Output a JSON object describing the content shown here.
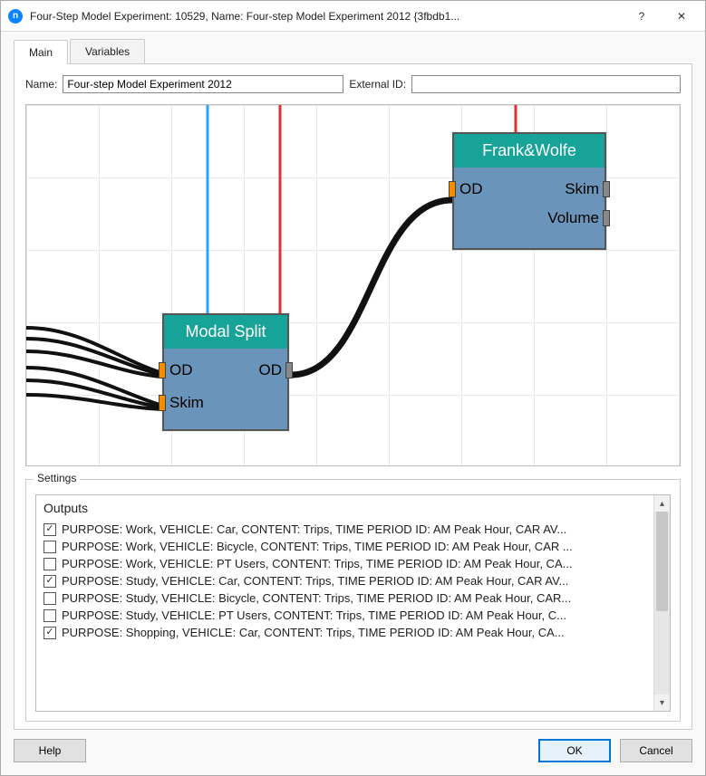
{
  "window": {
    "title": "Four-Step Model Experiment: 10529, Name: Four-step Model Experiment 2012  {3fbdb1...",
    "help_glyph": "?",
    "close_glyph": "✕"
  },
  "tabs": {
    "main": "Main",
    "variables": "Variables"
  },
  "form": {
    "name_label": "Name:",
    "name_value": "Four-step Model Experiment 2012",
    "extid_label": "External ID:",
    "extid_value": ""
  },
  "nodes": {
    "modal_split": {
      "title": "Modal Split",
      "port_in_od": "OD",
      "port_out_od": "OD",
      "port_in_skim": "Skim"
    },
    "frank_wolfe": {
      "title": "Frank&Wolfe",
      "port_in_od": "OD",
      "port_out_skim": "Skim",
      "port_out_volume": "Volume"
    }
  },
  "settings": {
    "legend": "Settings",
    "outputs_header": "Outputs",
    "rows": [
      {
        "checked": true,
        "text": "PURPOSE: Work, VEHICLE: Car, CONTENT: Trips, TIME PERIOD ID: AM Peak Hour, CAR AV..."
      },
      {
        "checked": false,
        "text": "PURPOSE: Work, VEHICLE: Bicycle, CONTENT: Trips, TIME PERIOD ID: AM Peak Hour, CAR ..."
      },
      {
        "checked": false,
        "text": "PURPOSE: Work, VEHICLE: PT Users, CONTENT: Trips, TIME PERIOD ID: AM Peak Hour, CA..."
      },
      {
        "checked": true,
        "text": "PURPOSE: Study, VEHICLE: Car, CONTENT: Trips, TIME PERIOD ID: AM Peak Hour, CAR AV..."
      },
      {
        "checked": false,
        "text": "PURPOSE: Study, VEHICLE: Bicycle, CONTENT: Trips, TIME PERIOD ID: AM Peak Hour, CAR..."
      },
      {
        "checked": false,
        "text": "PURPOSE: Study, VEHICLE: PT Users, CONTENT: Trips, TIME PERIOD ID: AM Peak Hour, C..."
      },
      {
        "checked": true,
        "text": "PURPOSE: Shopping, VEHICLE: Car, CONTENT: Trips, TIME PERIOD ID: AM Peak Hour, CA..."
      }
    ]
  },
  "buttons": {
    "help": "Help",
    "ok": "OK",
    "cancel": "Cancel"
  },
  "scroll": {
    "up": "▴",
    "down": "▾"
  }
}
